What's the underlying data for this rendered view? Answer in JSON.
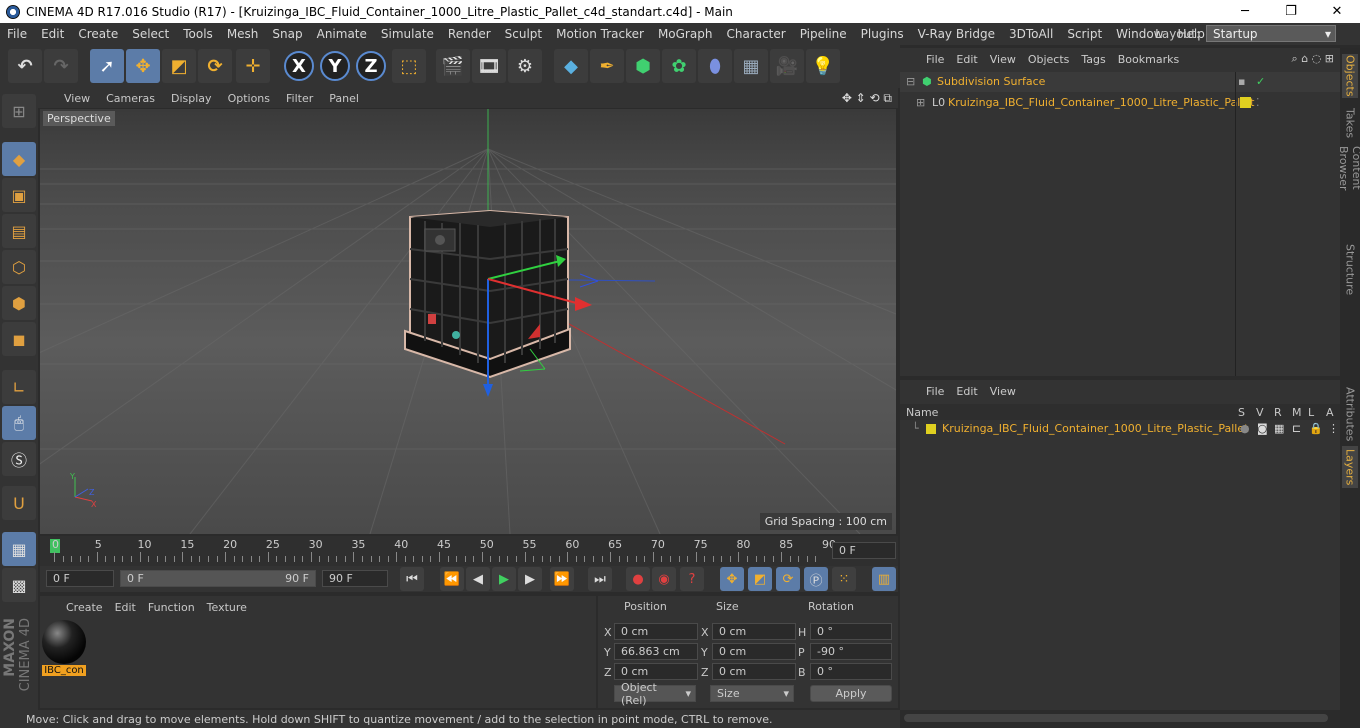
{
  "window": {
    "title": "CINEMA 4D R17.016 Studio (R17) - [Kruizinga_IBC_Fluid_Container_1000_Litre_Plastic_Pallet_c4d_standart.c4d] - Main",
    "minimize": "─",
    "maximize": "❐",
    "close": "✕"
  },
  "menu": [
    "File",
    "Edit",
    "Create",
    "Select",
    "Tools",
    "Mesh",
    "Snap",
    "Animate",
    "Simulate",
    "Render",
    "Sculpt",
    "Motion Tracker",
    "MoGraph",
    "Character",
    "Pipeline",
    "Plugins",
    "V-Ray Bridge",
    "3DToAll",
    "Script",
    "Window",
    "Help"
  ],
  "layout": {
    "label": "Layout:",
    "value": "Startup"
  },
  "toolbar": {
    "x": "X",
    "y": "Y",
    "z": "Z"
  },
  "viewport": {
    "menu": [
      "View",
      "Cameras",
      "Display",
      "Options",
      "Filter",
      "Panel"
    ],
    "label": "Perspective",
    "grid_spacing": "Grid Spacing : 100 cm"
  },
  "timeline": {
    "ticks": [
      "0",
      "5",
      "10",
      "15",
      "20",
      "25",
      "30",
      "35",
      "40",
      "45",
      "50",
      "55",
      "60",
      "65",
      "70",
      "75",
      "80",
      "85",
      "90"
    ],
    "current": "0 F"
  },
  "playbar": {
    "start": "0 F",
    "range_start": "0 F",
    "range_end": "90 F",
    "end": "90 F"
  },
  "material": {
    "menu": [
      "Create",
      "Edit",
      "Function",
      "Texture"
    ],
    "name": "IBC_con"
  },
  "coords": {
    "headers": [
      "Position",
      "Size",
      "Rotation"
    ],
    "rows": [
      {
        "axis": "X",
        "pos": "0 cm",
        "saxis": "X",
        "size": "0 cm",
        "raxis": "H",
        "rot": "0 °"
      },
      {
        "axis": "Y",
        "pos": "66.863 cm",
        "saxis": "Y",
        "size": "0 cm",
        "raxis": "P",
        "rot": "-90 °"
      },
      {
        "axis": "Z",
        "pos": "0 cm",
        "saxis": "Z",
        "size": "0 cm",
        "raxis": "B",
        "rot": "0 °"
      }
    ],
    "mode": "Object (Rel)",
    "size_mode": "Size",
    "apply": "Apply"
  },
  "objects": {
    "menu": [
      "File",
      "Edit",
      "View",
      "Objects",
      "Tags",
      "Bookmarks"
    ],
    "items": [
      "Subdivision Surface",
      "Kruizinga_IBC_Fluid_Container_1000_Litre_Plastic_Pallet"
    ]
  },
  "layers": {
    "menu": [
      "File",
      "Edit",
      "View"
    ],
    "columns": [
      "Name",
      "S",
      "V",
      "R",
      "M",
      "L",
      "A"
    ],
    "item": "Kruizinga_IBC_Fluid_Container_1000_Litre_Plastic_Pallet"
  },
  "sidetabs": [
    "Objects",
    "Takes",
    "Content Browser",
    "Structure",
    "Attributes",
    "Layers"
  ],
  "status": "Move: Click and drag to move elements. Hold down SHIFT to quantize movement / add to the selection in point mode, CTRL to remove.",
  "brand": {
    "maxon": "MAXON",
    "c4d": "CINEMA 4D"
  }
}
